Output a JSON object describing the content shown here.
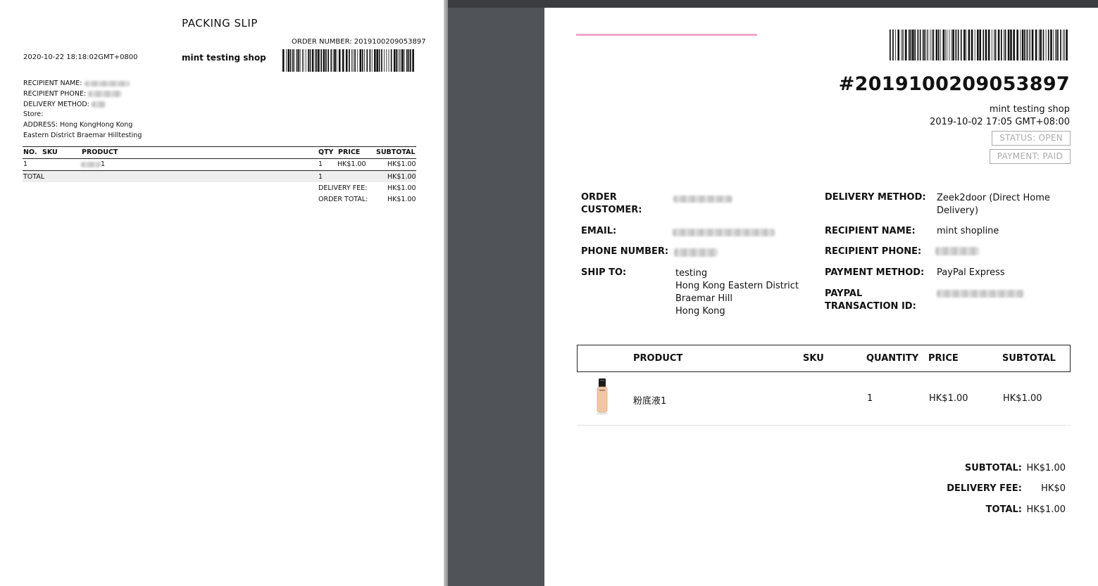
{
  "packing_slip": {
    "title": "PACKING SLIP",
    "order_number_label": "ORDER NUMBER: 2019100209053897",
    "datetime": "2020-10-22 18:18:02GMT+0800",
    "shop_name": "mint testing shop",
    "recipient_name_label": "RECIPIENT NAME:",
    "recipient_phone_label": "RECIPIENT PHONE:",
    "delivery_method_label": "DELIVERY METHOD:",
    "store_label": "Store:",
    "address_line1": "ADDRESS: Hong KongHong Kong",
    "address_line2": "Eastern District Braemar Hilltesting",
    "columns": {
      "no": "NO.",
      "sku": "SKU",
      "product": "PRODUCT",
      "qty": "QTY",
      "price": "PRICE",
      "subtotal": "SUBTOTAL"
    },
    "row": {
      "no": "1",
      "product_suffix": "1",
      "qty": "1",
      "price": "HK$1.00",
      "subtotal": "HK$1.00"
    },
    "total_label": "TOTAL",
    "total_qty": "1",
    "total_value": "HK$1.00",
    "delivery_fee_label": "DELIVERY FEE:",
    "delivery_fee_value": "HK$1.00",
    "order_total_label": "ORDER TOTAL:",
    "order_total_value": "HK$1.00"
  },
  "invoice": {
    "order_number": "#2019100209053897",
    "shop_name": "mint testing shop",
    "datetime": "2019-10-02 17:05 GMT+08:00",
    "status": "STATUS: OPEN",
    "payment": "PAYMENT: PAID",
    "order_customer_label": "ORDER\nCUSTOMER:",
    "email_label": "EMAIL:",
    "phone_label": "PHONE NUMBER:",
    "ship_to_label": "SHIP TO:",
    "ship_to_value": "testing\nHong Kong Eastern District\nBraemar Hill\nHong Kong",
    "delivery_method_label": "DELIVERY METHOD:",
    "delivery_method_value": "Zeek2door (Direct Home\nDelivery)",
    "recipient_name_label": "RECIPIENT NAME:",
    "recipient_name_value": "mint shopline",
    "recipient_phone_label": "RECIPIENT PHONE:",
    "payment_method_label": "PAYMENT METHOD:",
    "payment_method_value": "PayPal Express",
    "paypal_txn_label": "PAYPAL\nTRANSACTION ID:",
    "columns": {
      "product": "PRODUCT",
      "sku": "SKU",
      "quantity": "QUANTITY",
      "price": "PRICE",
      "subtotal": "SUBTOTAL"
    },
    "row": {
      "product_name": "粉底液1",
      "quantity": "1",
      "price": "HK$1.00",
      "subtotal": "HK$1.00"
    },
    "subtotal_label": "SUBTOTAL:",
    "subtotal_value": "HK$1.00",
    "delivery_fee_label": "DELIVERY FEE:",
    "delivery_fee_value": "HK$0",
    "total_label": "TOTAL:",
    "total_value": "HK$1.00"
  },
  "colors": {
    "accent_pink": "#f2a6c6",
    "viewer_gutter": "#505358",
    "status_border": "#aaaaaa"
  }
}
